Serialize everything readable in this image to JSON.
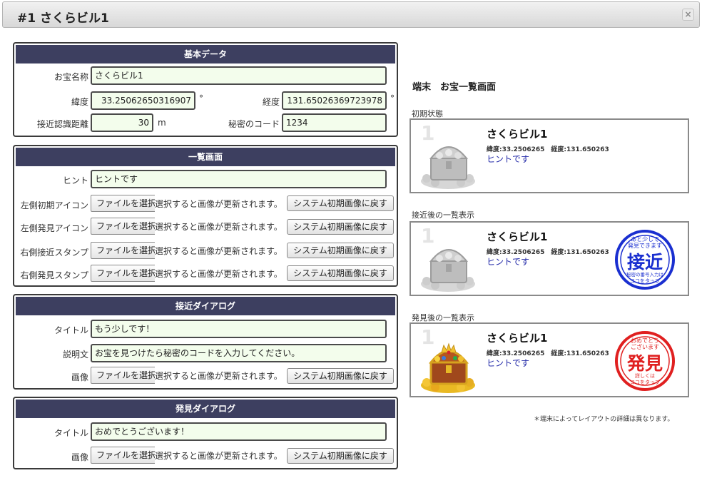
{
  "window": {
    "title": "#1 さくらビル1",
    "close_label": "×"
  },
  "basic": {
    "header": "基本データ",
    "name_label": "お宝名称",
    "name_value": "さくらビル1",
    "lat_label": "緯度",
    "lat_value": "33.25062650316907",
    "lat_unit": "°",
    "lng_label": "経度",
    "lng_value": "131.65026369723978",
    "lng_unit": "°",
    "distance_label": "接近認識距離",
    "distance_value": "30",
    "distance_unit": "m",
    "code_label": "秘密のコード",
    "code_value": "1234"
  },
  "list_screen": {
    "header": "一覧画面",
    "hint_label": "ヒント",
    "hint_value": "ヒントです",
    "left_init_label": "左側初期アイコン",
    "left_found_label": "左側発見アイコン",
    "right_near_label": "右側接近スタンプ",
    "right_found_label": "右側発見スタンプ"
  },
  "near_dialog": {
    "header": "接近ダイアログ",
    "title_label": "タイトル",
    "title_value": "もう少しです！",
    "desc_label": "説明文",
    "desc_value": "お宝を見つけたら秘密のコードを入力してください。",
    "image_label": "画像"
  },
  "found_dialog": {
    "header": "発見ダイアログ",
    "title_label": "タイトル",
    "title_value": "おめでとうございます！",
    "image_label": "画像"
  },
  "file": {
    "choose_label": "ファイルを選択",
    "note": "選択すると画像が更新されます。",
    "reset_label": "システム初期画像に戻す"
  },
  "preview": {
    "title": "端末　お宝一覧画面",
    "initial_label": "初期状態",
    "near_label": "接近後の一覧表示",
    "found_label": "発見後の一覧表示",
    "index": "1",
    "name": "さくらビル1",
    "coords": "緯度:33.2506265　経度:131.650263",
    "hint": "ヒントです",
    "near_stamp": {
      "top": "あと少しで",
      "top2": "発見できます",
      "main": "接近",
      "bottom": "秘密の番号入力は",
      "bottom2": "ココをタップ",
      "color": "#1a2fd0"
    },
    "found_stamp": {
      "top": "おめでとう",
      "top2": "ございます",
      "main": "発見",
      "bottom": "詳しくは",
      "bottom2": "ココをタップ",
      "color": "#e02020"
    },
    "footnote": "＊端末によってレイアウトの詳細は異なります。"
  }
}
